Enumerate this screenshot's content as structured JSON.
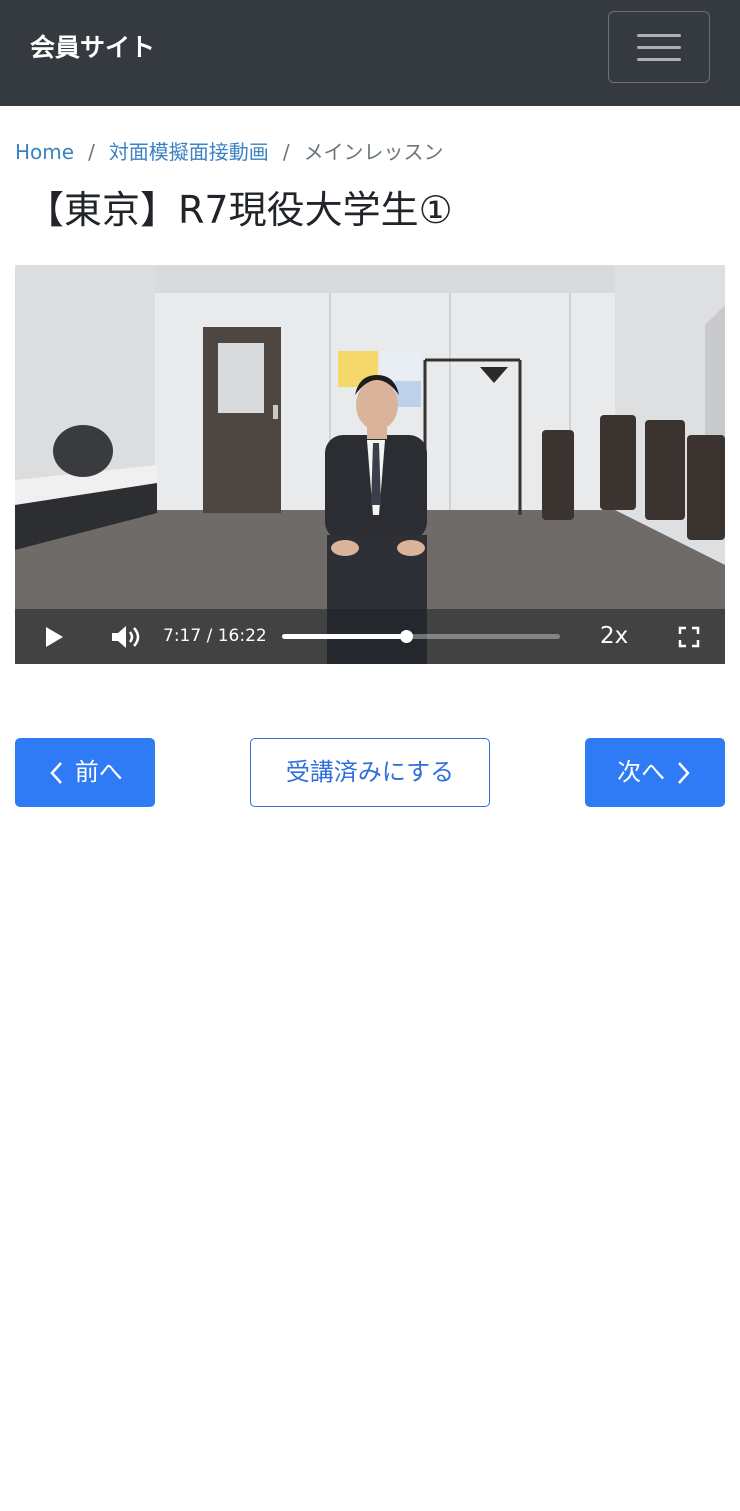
{
  "navbar": {
    "brand": "会員サイト",
    "menu_icon": "hamburger-menu-icon"
  },
  "breadcrumb": {
    "home": "Home",
    "category": "対面模擬面接動画",
    "current": "メインレッスン",
    "separator": "/"
  },
  "page": {
    "title": "【東京】R7現役大学生①"
  },
  "video": {
    "current_time": "7:17",
    "time_separator": "/",
    "duration": "16:22",
    "progress": 0.445,
    "speed": "2x",
    "icons": {
      "play": "play-icon",
      "volume": "volume-icon",
      "fullscreen": "fullscreen-icon"
    }
  },
  "navigation": {
    "prev_label": "前へ",
    "complete_label": "受講済みにする",
    "next_label": "次へ"
  },
  "colors": {
    "navbar_bg": "#343a40",
    "link": "#3b82c4",
    "primary": "#2f7bf6"
  }
}
